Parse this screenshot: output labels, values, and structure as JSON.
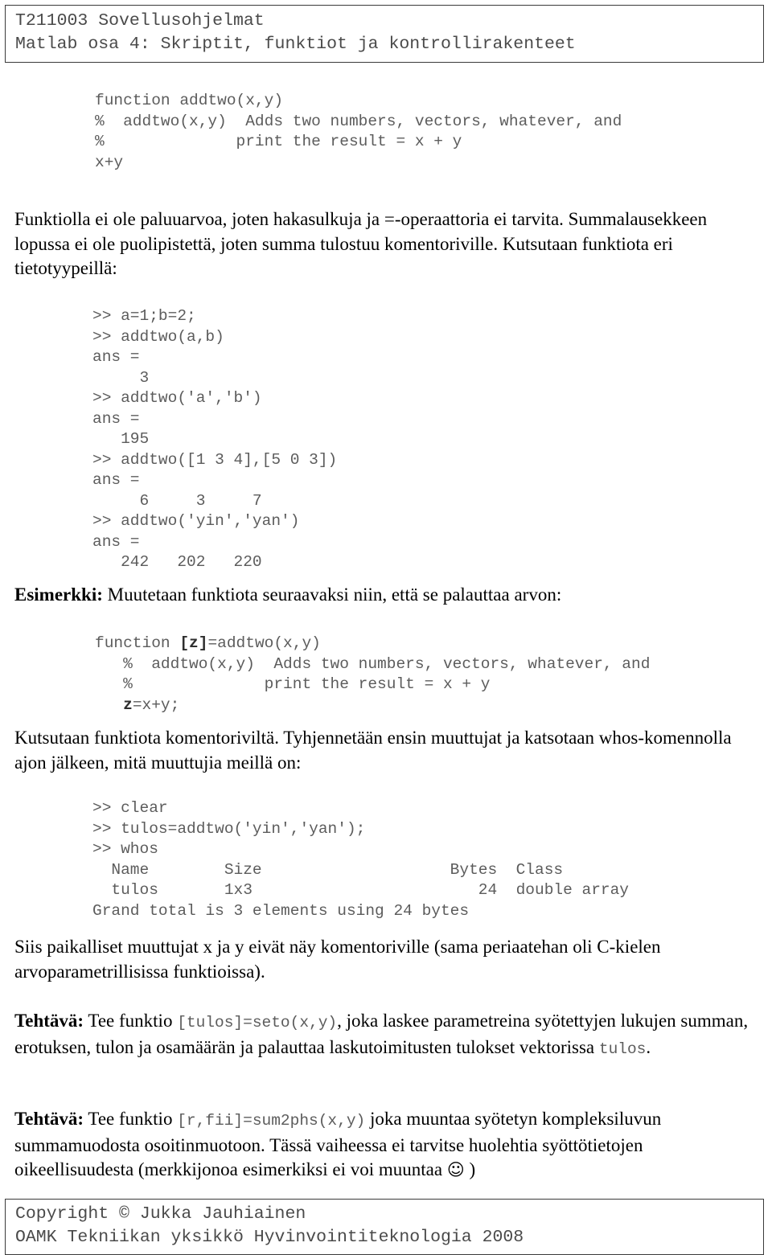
{
  "header": {
    "line1": "T211003 Sovellusohjelmat",
    "line2": "Matlab osa 4: Skriptit, funktiot ja kontrollirakenteet"
  },
  "code_block_1": "function addtwo(x,y)\n%  addtwo(x,y)  Adds two numbers, vectors, whatever, and\n%              print the result = x + y\nx+y",
  "paragraph_1": "Funktiolla ei ole paluuarvoa, joten hakasulkuja ja =-operaattoria ei tarvita. Summalausekkeen lopussa ei ole puolipistettä, joten summa tulostuu komentoriville. Kutsutaan funktiota eri tietotyypeillä:",
  "session_block_1": ">> a=1;b=2;\n>> addtwo(a,b)\nans =\n     3\n>> addtwo('a','b')\nans =\n   195\n>> addtwo([1 3 4],[5 0 3])\nans =\n     6     3     7\n>> addtwo('yin','yan')\nans =\n   242   202   220",
  "esimerkki": {
    "label": "Esimerkki:",
    "text": " Muutetaan funktiota seuraavaksi niin, että se palauttaa arvon:"
  },
  "code_block_2": {
    "line1_pre": "function ",
    "line1_bold": "[z]",
    "line1_post": "=addtwo(x,y)",
    "line2": "   %  addtwo(x,y)  Adds two numbers, vectors, whatever, and",
    "line3": "   %              print the result = x + y",
    "line4_pre": "   ",
    "line4_bold": "z",
    "line4_post": "=x+y;"
  },
  "paragraph_2": "Kutsutaan funktiota komentoriviltä. Tyhjennetään ensin muuttujat ja katsotaan whos-komennolla ajon jälkeen, mitä muuttujia meillä on:",
  "session_block_2": ">> clear\n>> tulos=addtwo('yin','yan');\n>> whos\n  Name        Size                    Bytes  Class\n  tulos       1x3                        24  double array\nGrand total is 3 elements using 24 bytes",
  "paragraph_3": "Siis paikalliset muuttujat x ja y eivät näy komentoriville (sama periaatehan oli C-kielen arvoparametrillisissa funktioissa).",
  "tehtava_1": {
    "label": "Tehtävä:",
    "part1": " Tee funktio ",
    "mono1": "[tulos]=seto(x,y)",
    "part2": ", joka laskee parametreina syötettyjen lukujen summan, erotuksen, tulon ja osamäärän ja palauttaa laskutoimitusten tulokset vektorissa ",
    "mono2": "tulos",
    "part3": "."
  },
  "tehtava_2": {
    "label": "Tehtävä:",
    "part1": " Tee funktio ",
    "mono1": "[r,fii]=sum2phs(x,y)",
    "part2": " joka muuntaa syötetyn kompleksiluvun summamuodosta osoitinmuotoon. Tässä vaiheessa ei tarvitse huolehtia syöttötietojen oikeellisuudesta (merkkijonoa esimerkiksi ei voi muuntaa ",
    "smiley": "☺",
    "part3": " )"
  },
  "footer": {
    "line1": "Copyright © Jukka Jauhiainen",
    "line2": "OAMK Tekniikan yksikkö Hyvinvointiteknologia 2008"
  }
}
